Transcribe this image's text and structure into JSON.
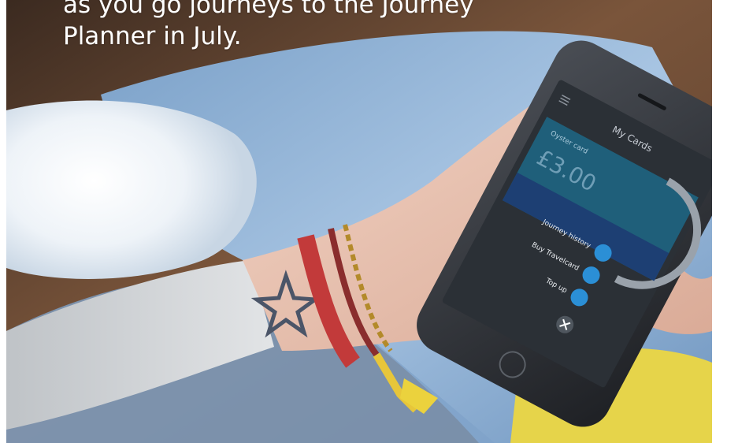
{
  "caption": {
    "line1": "as you go journeys to the Journey",
    "line2": "Planner in July."
  },
  "phone_screen": {
    "title": "My Cards",
    "card_label": "Oyster card",
    "balance": "£3.00",
    "menu_items": [
      {
        "label": "Journey history",
        "icon": "history-icon"
      },
      {
        "label": "Buy Travelcard",
        "icon": "travelcard-icon"
      },
      {
        "label": "Top up",
        "icon": "pound-icon"
      }
    ],
    "close_icon": "close-icon",
    "menu_icon": "hamburger-icon"
  },
  "colors": {
    "screen_bg": "#2b3036",
    "card_teal": "#1f5f7a",
    "card_blue": "#1d3f73",
    "fab_blue": "#2b8fd6",
    "wood": "#6b4a34",
    "jeans": "#8fb3d8"
  }
}
